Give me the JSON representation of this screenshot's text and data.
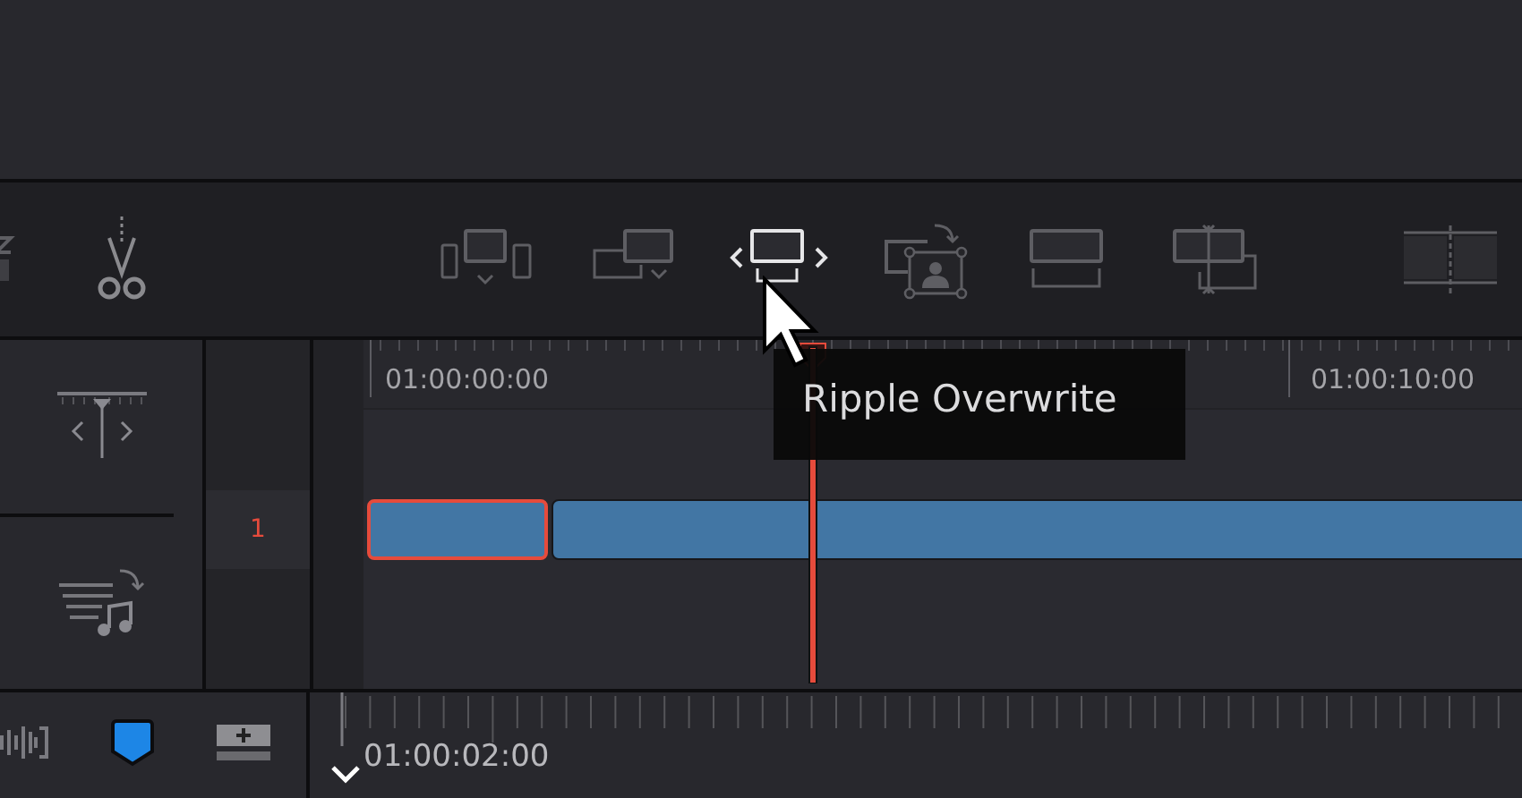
{
  "toolbar": {
    "tools": [
      {
        "kind": "zoom",
        "selected": false
      },
      {
        "kind": "blade",
        "selected": false
      },
      {
        "kind": "insert",
        "selected": false
      },
      {
        "kind": "overwrite",
        "selected": false
      },
      {
        "kind": "ripple",
        "selected": true
      },
      {
        "kind": "fit",
        "selected": false
      },
      {
        "kind": "append",
        "selected": false
      },
      {
        "kind": "replace",
        "selected": false
      },
      {
        "kind": "trim",
        "selected": false
      }
    ]
  },
  "tooltip": "Ripple Overwrite",
  "timeline": {
    "timecodes": [
      "01:00:00:00",
      "01:00:10:00"
    ],
    "track": {
      "number": "1"
    },
    "clips": [
      {
        "selected": true
      },
      {
        "selected": false
      }
    ]
  },
  "viewer_ruler": {
    "timecode": "01:00:02:00"
  }
}
